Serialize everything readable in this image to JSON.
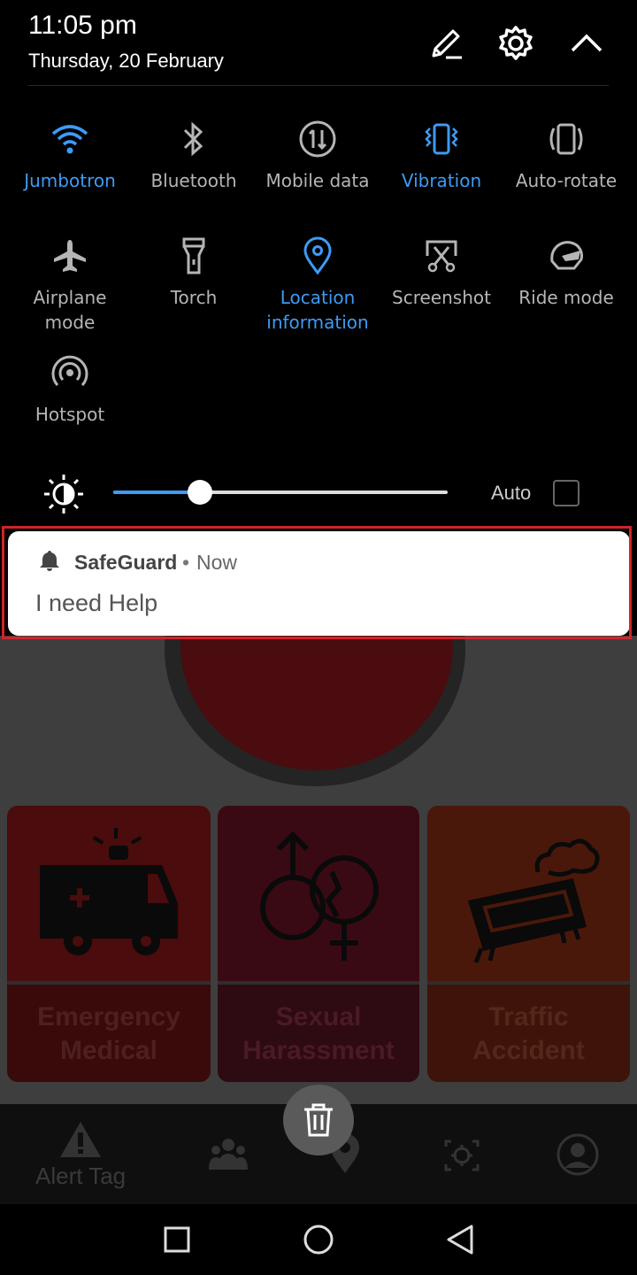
{
  "status": {
    "time": "11:05 pm",
    "date": "Thursday, 20 February"
  },
  "header_icons": [
    "edit-icon",
    "settings-icon",
    "collapse-icon"
  ],
  "quick_tiles": [
    {
      "label": "Jumbotron",
      "icon": "wifi-icon",
      "active": true
    },
    {
      "label": "Bluetooth",
      "icon": "bluetooth-icon",
      "active": false
    },
    {
      "label": "Mobile data",
      "icon": "mobile-data-icon",
      "active": false
    },
    {
      "label": "Vibration",
      "icon": "vibration-icon",
      "active": true
    },
    {
      "label": "Auto-rotate",
      "icon": "auto-rotate-icon",
      "active": false
    },
    {
      "label": "Airplane mode",
      "icon": "airplane-icon",
      "active": false
    },
    {
      "label": "Torch",
      "icon": "torch-icon",
      "active": false
    },
    {
      "label": "Location information",
      "icon": "location-icon",
      "active": true
    },
    {
      "label": "Screenshot",
      "icon": "screenshot-icon",
      "active": false
    },
    {
      "label": "Ride mode",
      "icon": "helmet-icon",
      "active": false
    },
    {
      "label": "Hotspot",
      "icon": "hotspot-icon",
      "active": false
    }
  ],
  "brightness": {
    "level": 0.26,
    "auto_label": "Auto",
    "auto_checked": false
  },
  "notification": {
    "app": "SafeGuard",
    "separator": "•",
    "time": "Now",
    "body": "I need Help"
  },
  "app": {
    "cards": [
      {
        "label_line1": "Emergency",
        "label_line2": "Medical",
        "icon": "ambulance-icon"
      },
      {
        "label_line1": "Sexual",
        "label_line2": "Harassment",
        "icon": "gender-icon"
      },
      {
        "label_line1": "Traffic",
        "label_line2": "Accident",
        "icon": "car-crash-icon"
      }
    ],
    "nav": {
      "alert_label": "Alert Tag"
    }
  },
  "colors": {
    "accent": "#3d9bf5",
    "highlight": "#d2232a"
  }
}
